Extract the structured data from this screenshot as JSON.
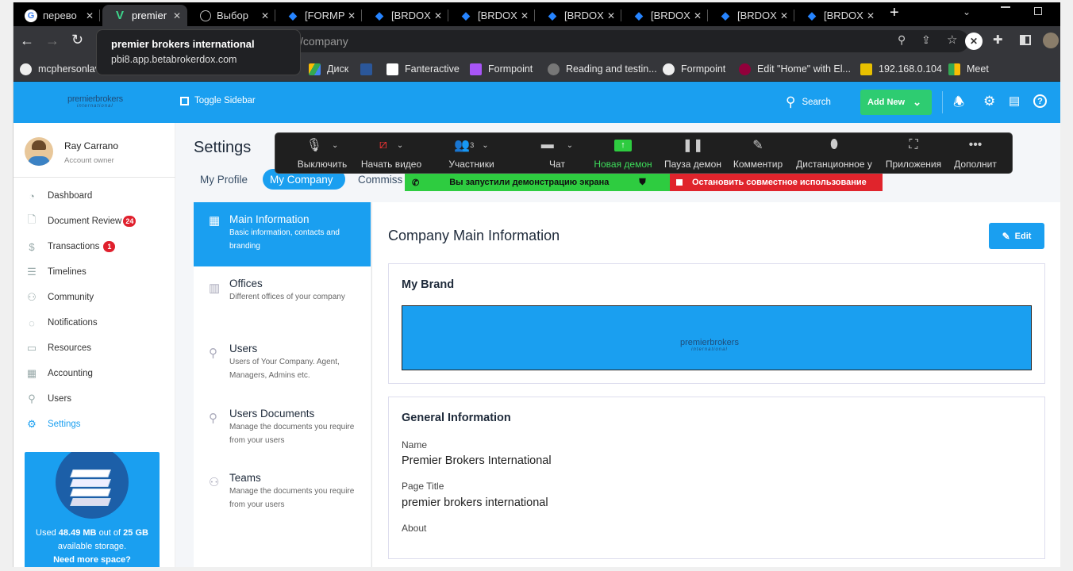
{
  "browser": {
    "tabs": [
      {
        "title": "перево",
        "icon": "google-icon",
        "active": false
      },
      {
        "title": "premier",
        "icon": "v-logo-icon",
        "active": true
      },
      {
        "title": "Выбор",
        "icon": "openai-icon",
        "active": false
      },
      {
        "title": "[FORMP",
        "icon": "diamond-icon",
        "active": false
      },
      {
        "title": "[BRDOX",
        "icon": "diamond-icon",
        "active": false
      },
      {
        "title": "[BRDOX",
        "icon": "diamond-icon",
        "active": false
      },
      {
        "title": "[BRDOX",
        "icon": "diamond-icon",
        "active": false
      },
      {
        "title": "[BRDOX",
        "icon": "diamond-icon",
        "active": false
      },
      {
        "title": "[BRDOX",
        "icon": "diamond-icon",
        "active": false
      },
      {
        "title": "[BRDOX",
        "icon": "diamond-icon",
        "active": false
      }
    ],
    "tooltip": {
      "title": "premier brokers international",
      "url": "pbi8.app.betabrokerdox.com"
    },
    "address_partial": "s/company",
    "bookmarks": [
      "mcphersonlav",
      "Диск",
      "Fanteractive",
      "Formpoint",
      "Reading and testin...",
      "Formpoint",
      "Edit \"Home\" with El...",
      "192.168.0.104",
      "Meet"
    ]
  },
  "topbar": {
    "toggle_label": "Toggle Sidebar",
    "search_label": "Search",
    "add_new_label": "Add New",
    "logo_text": "premierbrokers",
    "logo_sub": "international"
  },
  "user": {
    "name": "Ray Carrano",
    "role": "Account owner"
  },
  "sidebar": {
    "items": [
      {
        "label": "Dashboard",
        "icon": "gauge-icon",
        "badge": ""
      },
      {
        "label": "Document Review",
        "icon": "document-icon",
        "badge": "24"
      },
      {
        "label": "Transactions",
        "icon": "dollar-icon",
        "badge": "1"
      },
      {
        "label": "Timelines",
        "icon": "timeline-icon",
        "badge": ""
      },
      {
        "label": "Community",
        "icon": "community-icon",
        "badge": ""
      },
      {
        "label": "Notifications",
        "icon": "chat-icon",
        "badge": ""
      },
      {
        "label": "Resources",
        "icon": "folder-icon",
        "badge": ""
      },
      {
        "label": "Accounting",
        "icon": "calculator-icon",
        "badge": ""
      },
      {
        "label": "Users",
        "icon": "user-icon",
        "badge": ""
      },
      {
        "label": "Settings",
        "icon": "gear-icon",
        "badge": ""
      }
    ],
    "storage": {
      "line1": "Used",
      "used": "48.49 MB",
      "line1b": "out of",
      "total": "25 GB",
      "line2": "available storage.",
      "line3": "Need more space?"
    }
  },
  "page": {
    "title": "Settings",
    "tabs": [
      "My Profile",
      "My Company",
      "Commiss"
    ],
    "menu": [
      {
        "title": "Main Information",
        "sub": "Basic information, contacts and branding",
        "icon": "building-icon"
      },
      {
        "title": "Offices",
        "sub": "Different offices of your company",
        "icon": "office-icon"
      },
      {
        "title": "Users",
        "sub": "Users of Your Company. Agent, Managers, Admins etc.",
        "icon": "user-icon"
      },
      {
        "title": "Users Documents",
        "sub": "Manage the documents you require from your users",
        "icon": "user-doc-icon"
      },
      {
        "title": "Teams",
        "sub": "Manage the documents you require from your users",
        "icon": "team-icon"
      }
    ],
    "content_title": "Company Main Information",
    "edit_label": "Edit",
    "brand_title": "My Brand",
    "general_title": "General Information",
    "fields": [
      {
        "label": "Name",
        "value": "Premier Brokers International"
      },
      {
        "label": "Page Title",
        "value": "premier brokers international"
      },
      {
        "label": "About",
        "value": ""
      }
    ]
  },
  "meet": {
    "buttons": [
      {
        "label": "Выключить",
        "icon": "microphone-icon"
      },
      {
        "label": "Начать видео",
        "icon": "camera-off-icon"
      },
      {
        "label": "Участники",
        "icon": "participants-icon",
        "count": "3"
      },
      {
        "label": "Чат",
        "icon": "chat-bubble-icon"
      },
      {
        "label": "Новая демон",
        "icon": "share-screen-icon"
      },
      {
        "label": "Пауза демон",
        "icon": "pause-icon"
      },
      {
        "label": "Комментир",
        "icon": "pencil-icon"
      },
      {
        "label": "Дистанционное у",
        "icon": "mouse-icon"
      },
      {
        "label": "Приложения",
        "icon": "apps-icon"
      },
      {
        "label": "Дополнит",
        "icon": "more-icon"
      }
    ],
    "sharing_notice": "Вы запустили демонстрацию экрана",
    "stop_sharing": "Остановить совместное использование"
  },
  "colors": {
    "primary": "#1a9ff0",
    "green": "#22c55e",
    "red": "#e0242c"
  }
}
